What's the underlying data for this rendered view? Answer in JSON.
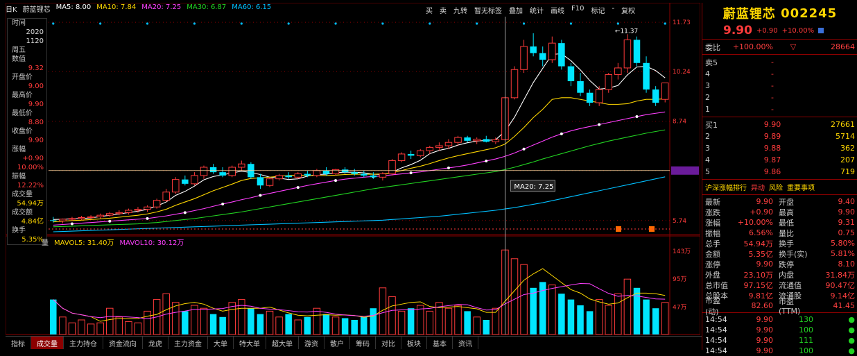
{
  "header": {
    "period": "日K",
    "stock_name": "蔚蓝锂芯",
    "ma_legend": [
      {
        "label": "MA5: 8.00",
        "color": "#ffffff"
      },
      {
        "label": "MA10: 7.84",
        "color": "#ffd700"
      },
      {
        "label": "MA20: 7.25",
        "color": "#ff40ff"
      },
      {
        "label": "MA30: 6.87",
        "color": "#22d322"
      },
      {
        "label": "MA60: 6.15",
        "color": "#00bfff"
      }
    ]
  },
  "toolbar": [
    "买",
    "卖",
    "九转",
    "暂无标签",
    "叠加",
    "统计",
    "画线",
    "F10",
    "标记",
    "-",
    "复权"
  ],
  "left_info": [
    {
      "label": "时间",
      "value": "2020"
    },
    {
      "label": "",
      "value": "1120"
    },
    {
      "label": "周五",
      "value": ""
    },
    {
      "label": "数值",
      "value": "9.32"
    },
    {
      "label": "开盘价",
      "value": "9.00"
    },
    {
      "label": "最高价",
      "value": "9.90"
    },
    {
      "label": "最低价",
      "value": "8.80"
    },
    {
      "label": "收盘价",
      "value": "9.90"
    },
    {
      "label": "涨幅",
      "value": "+0.90"
    },
    {
      "label": "",
      "value": "10.00%"
    },
    {
      "label": "振幅",
      "value": "12.22%"
    },
    {
      "label": "成交量",
      "value": "54.94万"
    },
    {
      "label": "成交额",
      "value": "4.84亿"
    },
    {
      "label": "换手",
      "value": "5.35%"
    }
  ],
  "price_axis": [
    "11.73",
    "10.24",
    "8.74",
    "7.25",
    "5.74"
  ],
  "crosshair_label": "MA20: 7.25",
  "high_marker": "11.37",
  "vol_header": [
    {
      "label": "量",
      "color": "#c8c8c8"
    },
    {
      "label": "MAVOL5: 31.40万",
      "color": "#ffd700"
    },
    {
      "label": "MAVOL10: 30.12万",
      "color": "#ff40ff"
    }
  ],
  "vol_axis": [
    "143万",
    "95万",
    "47万"
  ],
  "bottom_tabs": [
    "指标",
    "成交量",
    "主力持仓",
    "资金流向",
    "龙虎",
    "主力资金",
    "大单",
    "特大单",
    "超大单",
    "游资",
    "散户",
    "筹码",
    "对比",
    "板块",
    "基本",
    "资讯"
  ],
  "right_panel": {
    "name": "蔚蓝锂芯",
    "code": "002245",
    "price": "9.90",
    "change": "+0.90",
    "change_pct": "+10.00%",
    "wei_bi_label": "委比",
    "wei_bi": "+100.00%",
    "wei_cha": "28664",
    "asks": [
      {
        "label": "卖5",
        "price": "-",
        "vol": ""
      },
      {
        "label": "4",
        "price": "-",
        "vol": ""
      },
      {
        "label": "3",
        "price": "-",
        "vol": ""
      },
      {
        "label": "2",
        "price": "-",
        "vol": ""
      },
      {
        "label": "1",
        "price": "-",
        "vol": ""
      }
    ],
    "bids": [
      {
        "label": "买1",
        "price": "9.90",
        "vol": "27661"
      },
      {
        "label": "2",
        "price": "9.89",
        "vol": "5714"
      },
      {
        "label": "3",
        "price": "9.88",
        "vol": "362"
      },
      {
        "label": "4",
        "price": "9.87",
        "vol": "207"
      },
      {
        "label": "5",
        "price": "9.86",
        "vol": "719"
      }
    ],
    "status_line": [
      "沪深涨幅排行",
      "异动",
      "风险",
      "重要事项"
    ],
    "stats": [
      {
        "l": "最新",
        "v": "9.90",
        "l2": "开盘",
        "v2": "9.40"
      },
      {
        "l": "涨跌",
        "v": "+0.90",
        "l2": "最高",
        "v2": "9.90"
      },
      {
        "l": "涨幅",
        "v": "+10.00%",
        "l2": "最低",
        "v2": "9.31"
      },
      {
        "l": "振幅",
        "v": "6.56%",
        "l2": "量比",
        "v2": "0.75"
      },
      {
        "l": "总手",
        "v": "54.94万",
        "l2": "换手",
        "v2": "5.80%"
      },
      {
        "l": "金额",
        "v": "5.35亿",
        "l2": "换手(实)",
        "v2": "5.81%"
      },
      {
        "l": "涨停",
        "v": "9.90",
        "l2": "跌停",
        "v2": "8.10"
      },
      {
        "l": "外盘",
        "v": "23.10万",
        "l2": "内盘",
        "v2": "31.84万"
      },
      {
        "l": "总市值",
        "v": "97.15亿",
        "l2": "流通值",
        "v2": "90.47亿"
      },
      {
        "l": "总股本",
        "v": "9.81亿",
        "l2": "流通股",
        "v2": "9.14亿"
      },
      {
        "l": "市盈(动)",
        "v": "82.60",
        "l2": "市盈(TTM)",
        "v2": "41.45"
      }
    ],
    "ticks": [
      {
        "t": "14:54",
        "p": "9.90",
        "v": "130"
      },
      {
        "t": "14:54",
        "p": "9.90",
        "v": "100"
      },
      {
        "t": "14:54",
        "p": "9.90",
        "v": "111"
      },
      {
        "t": "14:54",
        "p": "9.90",
        "v": "100"
      }
    ]
  },
  "chart_data": {
    "type": "candlestick",
    "candles": [
      [
        5.75,
        5.85,
        5.68,
        5.73
      ],
      [
        5.73,
        5.8,
        5.65,
        5.78
      ],
      [
        5.78,
        5.85,
        5.72,
        5.8
      ],
      [
        5.8,
        5.88,
        5.75,
        5.83
      ],
      [
        5.83,
        5.9,
        5.78,
        5.85
      ],
      [
        5.85,
        5.95,
        5.8,
        5.9
      ],
      [
        5.9,
        6.0,
        5.85,
        5.95
      ],
      [
        5.95,
        6.05,
        5.9,
        5.98
      ],
      [
        5.98,
        6.1,
        5.92,
        6.05
      ],
      [
        6.05,
        6.15,
        5.98,
        6.08
      ],
      [
        6.08,
        6.2,
        6.0,
        6.15
      ],
      [
        6.15,
        6.4,
        6.1,
        6.35
      ],
      [
        6.35,
        6.7,
        6.3,
        6.6
      ],
      [
        6.6,
        7.05,
        6.55,
        6.98
      ],
      [
        6.98,
        7.1,
        6.8,
        6.85
      ],
      [
        6.85,
        7.2,
        6.8,
        7.1
      ],
      [
        7.1,
        7.4,
        7.0,
        7.35
      ],
      [
        7.35,
        7.45,
        7.15,
        7.2
      ],
      [
        7.2,
        7.35,
        7.05,
        7.1
      ],
      [
        7.1,
        7.4,
        7.05,
        7.35
      ],
      [
        7.35,
        7.55,
        7.25,
        7.45
      ],
      [
        7.45,
        7.5,
        7.0,
        7.05
      ],
      [
        7.05,
        7.15,
        6.7,
        6.8
      ],
      [
        6.8,
        7.05,
        6.75,
        7.0
      ],
      [
        7.0,
        7.15,
        6.95,
        7.1
      ],
      [
        7.1,
        7.2,
        7.0,
        7.05
      ],
      [
        7.05,
        7.2,
        7.0,
        7.15
      ],
      [
        7.15,
        7.25,
        7.05,
        7.1
      ],
      [
        7.1,
        7.3,
        7.05,
        7.25
      ],
      [
        7.25,
        7.35,
        7.1,
        7.15
      ],
      [
        7.15,
        7.3,
        7.1,
        7.28
      ],
      [
        7.28,
        7.35,
        7.15,
        7.2
      ],
      [
        7.2,
        7.3,
        7.1,
        7.15
      ],
      [
        7.15,
        7.25,
        7.05,
        7.1
      ],
      [
        7.1,
        7.2,
        7.0,
        7.05
      ],
      [
        7.05,
        7.2,
        6.95,
        7.15
      ],
      [
        7.15,
        7.6,
        7.1,
        7.55
      ],
      [
        7.55,
        7.8,
        7.5,
        7.75
      ],
      [
        7.75,
        7.85,
        7.6,
        7.7
      ],
      [
        7.7,
        7.9,
        7.65,
        7.85
      ],
      [
        7.85,
        8.0,
        7.75,
        7.95
      ],
      [
        7.95,
        8.1,
        7.85,
        8.0
      ],
      [
        8.0,
        8.2,
        7.9,
        8.1
      ],
      [
        8.1,
        8.3,
        8.0,
        8.25
      ],
      [
        8.25,
        8.3,
        8.1,
        8.15
      ],
      [
        8.15,
        8.25,
        8.05,
        8.2
      ],
      [
        8.2,
        8.3,
        8.1,
        8.12
      ],
      [
        8.12,
        8.25,
        8.05,
        8.18
      ],
      [
        8.18,
        9.5,
        8.15,
        9.45
      ],
      [
        9.45,
        10.4,
        9.4,
        10.3
      ],
      [
        10.3,
        11.2,
        10.2,
        11.0
      ],
      [
        11.0,
        11.4,
        10.7,
        10.8
      ],
      [
        10.8,
        11.0,
        10.4,
        10.6
      ],
      [
        10.6,
        11.3,
        10.5,
        11.1
      ],
      [
        11.1,
        11.2,
        10.3,
        10.4
      ],
      [
        10.4,
        10.5,
        9.8,
        9.95
      ],
      [
        9.95,
        10.2,
        9.5,
        9.6
      ],
      [
        9.6,
        9.7,
        9.2,
        9.3
      ],
      [
        9.3,
        9.8,
        9.2,
        9.7
      ],
      [
        9.7,
        10.2,
        9.6,
        10.15
      ],
      [
        10.15,
        10.5,
        10.0,
        10.35
      ],
      [
        10.35,
        11.37,
        10.2,
        11.2
      ],
      [
        11.2,
        11.3,
        10.4,
        10.5
      ],
      [
        10.5,
        10.7,
        9.6,
        9.7
      ],
      [
        9.7,
        9.8,
        9.2,
        9.3
      ],
      [
        9.4,
        9.9,
        9.31,
        9.9
      ]
    ],
    "volume_wan": [
      60,
      30,
      20,
      25,
      18,
      20,
      45,
      30,
      22,
      20,
      40,
      60,
      70,
      55,
      40,
      50,
      45,
      35,
      30,
      55,
      60,
      45,
      35,
      40,
      30,
      35,
      25,
      30,
      45,
      35,
      30,
      28,
      25,
      30,
      45,
      80,
      65,
      40,
      45,
      50,
      40,
      55,
      45,
      50,
      40,
      30,
      25,
      45,
      145,
      130,
      120,
      80,
      90,
      85,
      70,
      60,
      50,
      40,
      60,
      50,
      70,
      95,
      80,
      60,
      45,
      55
    ],
    "ma": {
      "MA5": [
        5.77,
        5.78,
        5.79,
        5.8,
        5.82,
        5.86,
        5.9,
        5.94,
        5.98,
        6.02,
        6.08,
        6.18,
        6.3,
        6.5,
        6.62,
        6.78,
        6.97,
        7.07,
        7.12,
        7.18,
        7.23,
        7.19,
        7.13,
        7.05,
        7.02,
        6.98,
        7.0,
        7.08,
        7.13,
        7.14,
        7.19,
        7.2,
        7.2,
        7.18,
        7.14,
        7.13,
        7.2,
        7.33,
        7.43,
        7.56,
        7.76,
        7.86,
        7.92,
        8.02,
        8.09,
        8.14,
        8.16,
        8.18,
        8.44,
        8.86,
        9.39,
        9.91,
        10.34,
        10.76,
        10.78,
        10.57,
        10.29,
        9.97,
        9.71,
        9.74,
        9.82,
        10.14,
        10.38,
        10.4,
        10.27,
        10.05
      ],
      "MA10": [
        5.7,
        5.72,
        5.74,
        5.75,
        5.77,
        5.79,
        5.81,
        5.84,
        5.87,
        5.9,
        5.94,
        6.0,
        6.08,
        6.2,
        6.3,
        6.4,
        6.52,
        6.64,
        6.74,
        6.84,
        6.95,
        7.01,
        7.03,
        7.05,
        7.08,
        7.1,
        7.11,
        7.1,
        7.1,
        7.1,
        7.11,
        7.13,
        7.14,
        7.14,
        7.14,
        7.15,
        7.18,
        7.25,
        7.32,
        7.38,
        7.46,
        7.55,
        7.63,
        7.7,
        7.76,
        7.82,
        7.88,
        7.94,
        8.05,
        8.28,
        8.55,
        8.85,
        9.1,
        9.4,
        9.45,
        9.45,
        9.4,
        9.35,
        9.3,
        9.25,
        9.25,
        9.27,
        9.35,
        9.4,
        9.4,
        9.42
      ],
      "MA20": [
        5.6,
        5.62,
        5.64,
        5.66,
        5.68,
        5.7,
        5.72,
        5.74,
        5.76,
        5.78,
        5.8,
        5.84,
        5.88,
        5.93,
        5.98,
        6.04,
        6.1,
        6.17,
        6.24,
        6.3,
        6.37,
        6.43,
        6.5,
        6.56,
        6.62,
        6.68,
        6.74,
        6.8,
        6.85,
        6.9,
        6.95,
        6.99,
        7.02,
        7.05,
        7.07,
        7.09,
        7.12,
        7.15,
        7.18,
        7.21,
        7.25,
        7.29,
        7.33,
        7.37,
        7.42,
        7.48,
        7.54,
        7.6,
        7.68,
        7.78,
        7.9,
        8.02,
        8.14,
        8.26,
        8.36,
        8.45,
        8.52,
        8.58,
        8.64,
        8.7,
        8.76,
        8.82,
        8.88,
        8.94,
        8.98,
        9.02
      ],
      "MA30": [
        5.55,
        5.56,
        5.57,
        5.58,
        5.59,
        5.6,
        5.61,
        5.62,
        5.63,
        5.64,
        5.66,
        5.68,
        5.71,
        5.74,
        5.77,
        5.8,
        5.84,
        5.88,
        5.92,
        5.96,
        6.0,
        6.05,
        6.1,
        6.15,
        6.2,
        6.25,
        6.3,
        6.35,
        6.4,
        6.45,
        6.5,
        6.55,
        6.6,
        6.65,
        6.7,
        6.74,
        6.78,
        6.82,
        6.86,
        6.9,
        6.94,
        6.98,
        7.02,
        7.06,
        7.1,
        7.14,
        7.18,
        7.22,
        7.28,
        7.35,
        7.43,
        7.51,
        7.6,
        7.68,
        7.76,
        7.84,
        7.92,
        8.0,
        8.07,
        8.14,
        8.2,
        8.26,
        8.32,
        8.38,
        8.43,
        8.48
      ],
      "MA60": [
        5.4,
        5.41,
        5.42,
        5.43,
        5.44,
        5.45,
        5.46,
        5.47,
        5.48,
        5.49,
        5.5,
        5.51,
        5.52,
        5.53,
        5.54,
        5.55,
        5.56,
        5.57,
        5.58,
        5.59,
        5.6,
        5.61,
        5.62,
        5.63,
        5.64,
        5.65,
        5.66,
        5.67,
        5.68,
        5.69,
        5.7,
        5.71,
        5.72,
        5.73,
        5.74,
        5.75,
        5.77,
        5.79,
        5.81,
        5.83,
        5.85,
        5.87,
        5.9,
        5.93,
        5.96,
        5.99,
        6.02,
        6.05,
        6.09,
        6.13,
        6.18,
        6.23,
        6.28,
        6.34,
        6.4,
        6.46,
        6.52,
        6.58,
        6.64,
        6.7,
        6.76,
        6.82,
        6.88,
        6.94,
        7.0,
        7.06
      ]
    },
    "ylim": [
      5.4,
      11.9
    ],
    "vol_max_wan": 150,
    "crosshair_index": 48,
    "crosshair_value": 7.25,
    "high_index": 61,
    "high_value": 11.37
  },
  "colors": {
    "up": "#ff3b3b",
    "down": "#00e5ff",
    "bg": "#000000",
    "accent": "#8b0000"
  }
}
